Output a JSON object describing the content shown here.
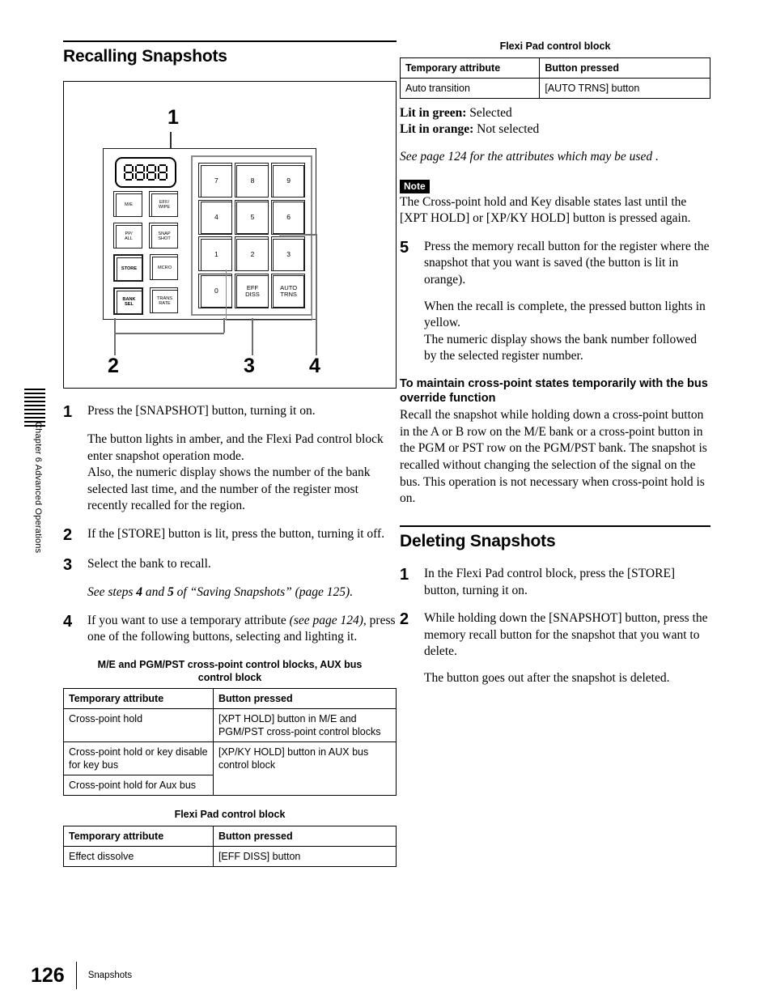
{
  "sidebar": {
    "chapter_label": "Chapter 6  Advanced Operations"
  },
  "footer": {
    "page_number": "126",
    "running_head": "Snapshots"
  },
  "left_column": {
    "section_title": "Recalling Snapshots",
    "figure": {
      "callouts": [
        "1",
        "2",
        "3",
        "4"
      ],
      "numeric_display": "8888",
      "panel_buttons": [
        "M/E",
        "EFF/ WIPE",
        "PP/ ALL",
        "SNAP SHOT",
        "STORE",
        "MCRO",
        "BANK SEL",
        "TRANS RATE"
      ],
      "panel_buttons_split": [
        [
          "M/E",
          ""
        ],
        [
          "EFF/",
          "WIPE"
        ],
        [
          "PP/",
          "ALL"
        ],
        [
          "SNAP",
          "SHOT"
        ],
        [
          "STORE",
          ""
        ],
        [
          "MCRO",
          ""
        ],
        [
          "BANK",
          "SEL"
        ],
        [
          "TRANS",
          "RATE"
        ]
      ],
      "keypad": [
        [
          "7",
          ""
        ],
        [
          "8",
          ""
        ],
        [
          "9",
          ""
        ],
        [
          "4",
          ""
        ],
        [
          "5",
          ""
        ],
        [
          "6",
          ""
        ],
        [
          "1",
          ""
        ],
        [
          "2",
          ""
        ],
        [
          "3",
          ""
        ],
        [
          "0",
          ""
        ],
        [
          "EFF",
          "DISS"
        ],
        [
          "AUTO",
          "TRNS"
        ]
      ]
    },
    "steps": [
      {
        "num": "1",
        "text": "Press the [SNAPSHOT] button, turning it on.",
        "body": [
          "The button lights in amber, and the Flexi Pad control block enter snapshot operation mode.",
          "Also, the numeric display shows the number of the bank selected last time, and the number of the register most recently recalled for the region."
        ]
      },
      {
        "num": "2",
        "text": "If the [STORE] button is lit, press the button, turning it off."
      },
      {
        "num": "3",
        "text": "Select the bank to recall.",
        "italic_note_parts": {
          "a": "See steps ",
          "b": "4",
          "c": " and ",
          "d": "5",
          "e": " of “Saving Snapshots” (page 125)."
        }
      },
      {
        "num": "4",
        "text_parts": {
          "a": "If you want to use a temporary attribute ",
          "b": "(see page 124)",
          "c": ", press one of the following buttons, selecting and lighting it."
        }
      }
    ],
    "table1": {
      "caption": "M/E and PGM/PST cross-point control blocks, AUX bus control block",
      "headers": [
        "Temporary attribute",
        "Button pressed"
      ],
      "rows": [
        [
          "Cross-point hold",
          "[XPT HOLD] button in M/E and PGM/PST cross-point control blocks"
        ],
        [
          "Cross-point hold or key disable for key bus",
          "[XP/KY HOLD] button in AUX bus control block"
        ],
        [
          "Cross-point hold for Aux bus",
          ""
        ]
      ]
    },
    "table2": {
      "caption": "Flexi Pad control block",
      "headers": [
        "Temporary attribute",
        "Button pressed"
      ],
      "rows": [
        [
          "Effect dissolve",
          "[EFF DISS] button"
        ]
      ]
    }
  },
  "right_column": {
    "table3": {
      "caption": "Flexi Pad control block",
      "headers": [
        "Temporary attribute",
        "Button pressed"
      ],
      "rows": [
        [
          "Auto transition",
          "[AUTO TRNS] button"
        ]
      ]
    },
    "lit_states": [
      {
        "label": "Lit in green:",
        "value": " Selected"
      },
      {
        "label": "Lit in orange:",
        "value": " Not selected"
      }
    ],
    "see_page_note": "See page 124 for the attributes which may be used .",
    "note": {
      "badge": "Note",
      "text": "The Cross-point hold and Key disable states last until the [XPT HOLD] or [XP/KY HOLD] button is pressed again."
    },
    "step5": {
      "num": "5",
      "text": "Press the memory recall button for the register where the snapshot that you want is saved (the button is lit in orange).",
      "body": [
        "When the recall is complete, the pressed button lights in yellow.",
        "The numeric display shows the bank number followed by the selected register number."
      ]
    },
    "bus_override": {
      "heading": "To maintain cross-point states temporarily with the bus override function",
      "text": "Recall the snapshot while holding down a cross-point button in the A or B row on the M/E bank or a cross-point button in the PGM or PST row on the PGM/PST bank. The snapshot is recalled without changing the selection of the signal on the bus. This operation is not necessary when cross-point hold is on."
    },
    "section_title": "Deleting Snapshots",
    "delete_steps": [
      {
        "num": "1",
        "text": "In the Flexi Pad control block, press the [STORE] button, turning it on."
      },
      {
        "num": "2",
        "text": "While holding down the [SNAPSHOT] button, press the memory recall button for the snapshot that you want to delete.",
        "body": [
          "The button goes out after the snapshot is deleted."
        ]
      }
    ]
  }
}
